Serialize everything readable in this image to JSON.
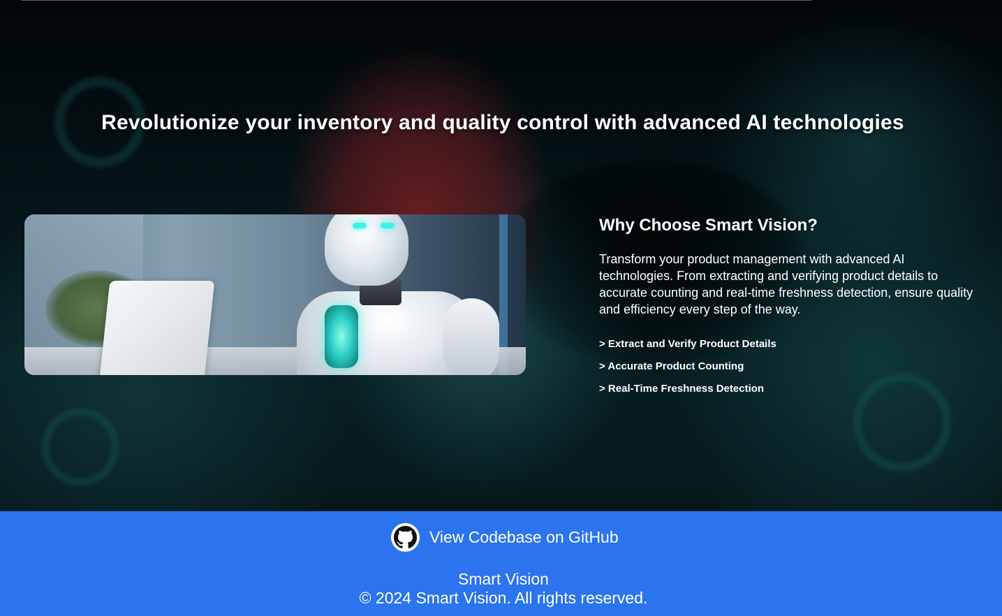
{
  "hero": {
    "headline": "Revolutionize your inventory and quality control with advanced AI technologies",
    "image_icon": "robot-with-laptop-illustration"
  },
  "why": {
    "title": "Why Choose Smart Vision?",
    "description": "Transform your product management with advanced AI technologies. From extracting and verifying product details to accurate counting and real-time freshness detection, ensure quality and efficiency every step of the way.",
    "features": [
      "> Extract and Verify Product Details",
      "> Accurate Product Counting",
      "> Real-Time Freshness Detection"
    ]
  },
  "footer": {
    "github_label": "View Codebase on GitHub",
    "github_icon": "github-icon",
    "brand": "Smart Vision",
    "copyright": "© 2024 Smart Vision. All rights reserved.",
    "background_color": "#2b74ee"
  }
}
